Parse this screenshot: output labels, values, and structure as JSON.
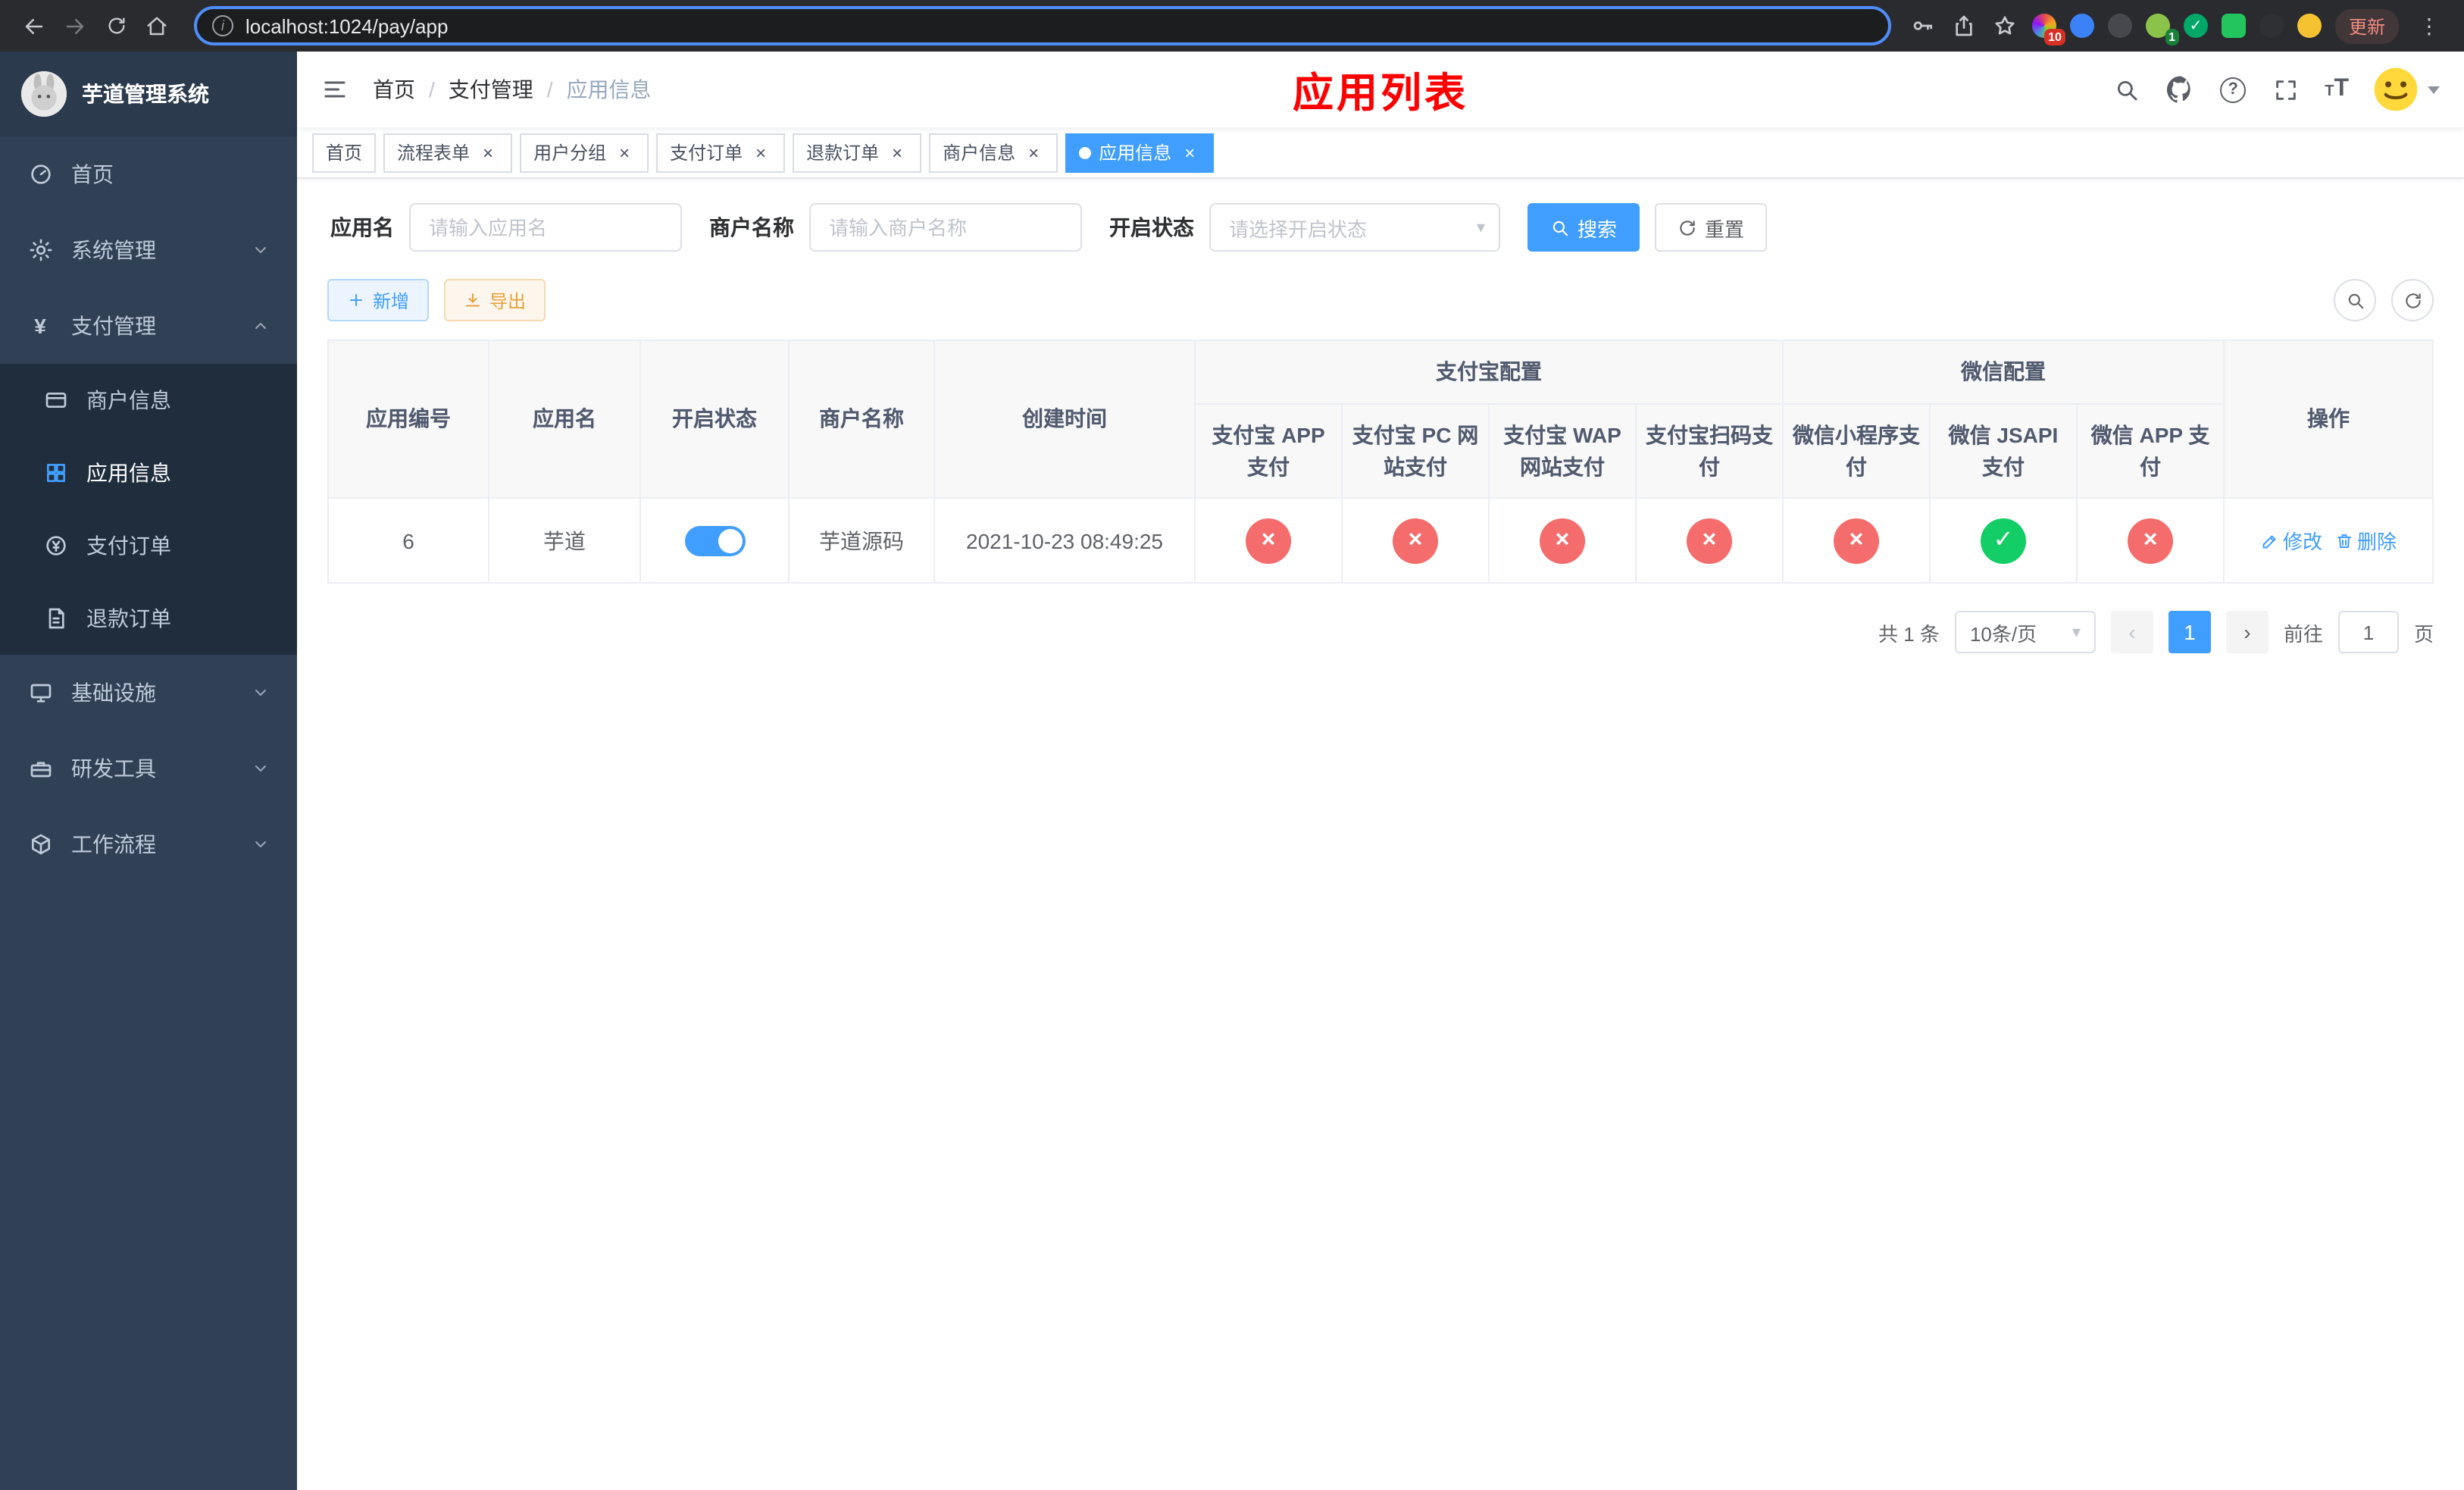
{
  "icons": {
    "close": "×",
    "check": "✓",
    "cross": "×",
    "back": "←",
    "forward": "→",
    "more": "⋮",
    "info": "i",
    "caret": "▾",
    "prev": "‹",
    "next": "›",
    "question": "?",
    "yen": "¥",
    "plus": "+",
    "font_size_large": "T",
    "font_size_small": "T"
  },
  "colors": {
    "primary": "#409eff",
    "success": "#13ce66",
    "danger": "#f56c6c",
    "warning": "#e6a23c",
    "title_red": "#fe0000"
  },
  "browser": {
    "url": "localhost:1024/pay/app",
    "update_label": "更新",
    "extension_badge": "10",
    "profile_badge": "1"
  },
  "sidebar": {
    "title": "芋道管理系统",
    "items": [
      {
        "label": "首页"
      },
      {
        "label": "系统管理"
      },
      {
        "label": "支付管理"
      },
      {
        "label": "商户信息"
      },
      {
        "label": "应用信息"
      },
      {
        "label": "支付订单"
      },
      {
        "label": "退款订单"
      },
      {
        "label": "基础设施"
      },
      {
        "label": "研发工具"
      },
      {
        "label": "工作流程"
      }
    ]
  },
  "header": {
    "breadcrumb": [
      "首页",
      "支付管理",
      "应用信息"
    ],
    "page_title": "应用列表"
  },
  "tabs": [
    {
      "label": "首页"
    },
    {
      "label": "流程表单"
    },
    {
      "label": "用户分组"
    },
    {
      "label": "支付订单"
    },
    {
      "label": "退款订单"
    },
    {
      "label": "商户信息"
    },
    {
      "label": "应用信息"
    }
  ],
  "filters": {
    "app_name_label": "应用名",
    "app_name_placeholder": "请输入应用名",
    "merchant_label": "商户名称",
    "merchant_placeholder": "请输入商户名称",
    "status_label": "开启状态",
    "status_placeholder": "请选择开启状态",
    "search_label": "搜索",
    "reset_label": "重置"
  },
  "toolbar": {
    "add_label": "新增",
    "export_label": "导出"
  },
  "table": {
    "columns": [
      "应用编号",
      "应用名",
      "开启状态",
      "商户名称",
      "创建时间"
    ],
    "alipay_group": "支付宝配置",
    "alipay_columns": [
      "支付宝 APP 支付",
      "支付宝 PC 网站支付",
      "支付宝 WAP 网站支付",
      "支付宝扫码支付"
    ],
    "wechat_group": "微信配置",
    "wechat_columns": [
      "微信小程序支付",
      "微信 JSAPI 支付",
      "微信 APP 支付"
    ],
    "action_label": "操作",
    "row": {
      "id": "6",
      "name": "芋道",
      "enabled": true,
      "merchant": "芋道源码",
      "created_at": "2021-10-23 08:49:25",
      "configs": [
        false,
        false,
        false,
        false,
        false,
        true,
        false
      ],
      "edit_label": "修改",
      "delete_label": "删除"
    }
  },
  "pagination": {
    "total_label": "共 1 条",
    "page_size_label": "10条/页",
    "current_page": "1",
    "goto_label": "前往",
    "goto_value": "1",
    "unit_label": "页"
  }
}
